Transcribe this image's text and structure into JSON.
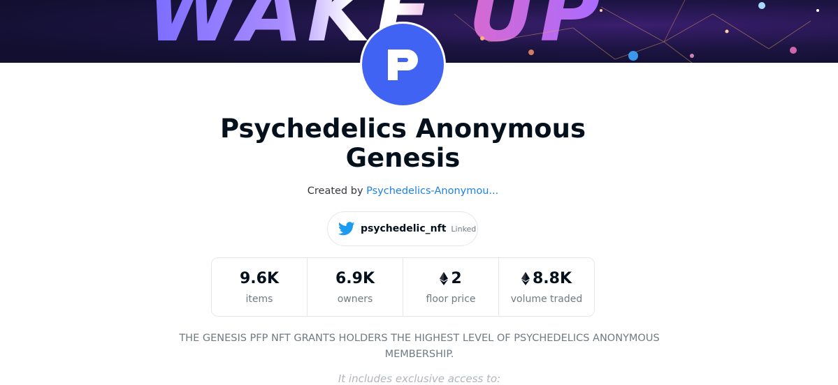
{
  "banner": {
    "text": "WAKE UP"
  },
  "avatar": {
    "letter": "P"
  },
  "collection": {
    "title": "Psychedelics Anonymous Genesis",
    "created_by_prefix": "Created by",
    "creator": "Psychedelics-Anonymou..."
  },
  "twitter": {
    "handle": "psychedelic_nft",
    "status": "Linked",
    "icon": "twitter-bird-icon"
  },
  "stats": [
    {
      "value": "9.6K",
      "label": "items",
      "eth": false
    },
    {
      "value": "6.9K",
      "label": "owners",
      "eth": false
    },
    {
      "value": "2",
      "label": "floor price",
      "eth": true
    },
    {
      "value": "8.8K",
      "label": "volume traded",
      "eth": true
    }
  ],
  "description": {
    "text": "THE GENESIS PFP NFT GRANTS HOLDERS THE HIGHEST LEVEL OF PSYCHEDELICS ANONYMOUS MEMBERSHIP.",
    "more": "It includes exclusive access to:"
  },
  "colors": {
    "accent": "#2081e2",
    "avatar_bg": "#4163f4",
    "twitter": "#1d9bf0"
  }
}
